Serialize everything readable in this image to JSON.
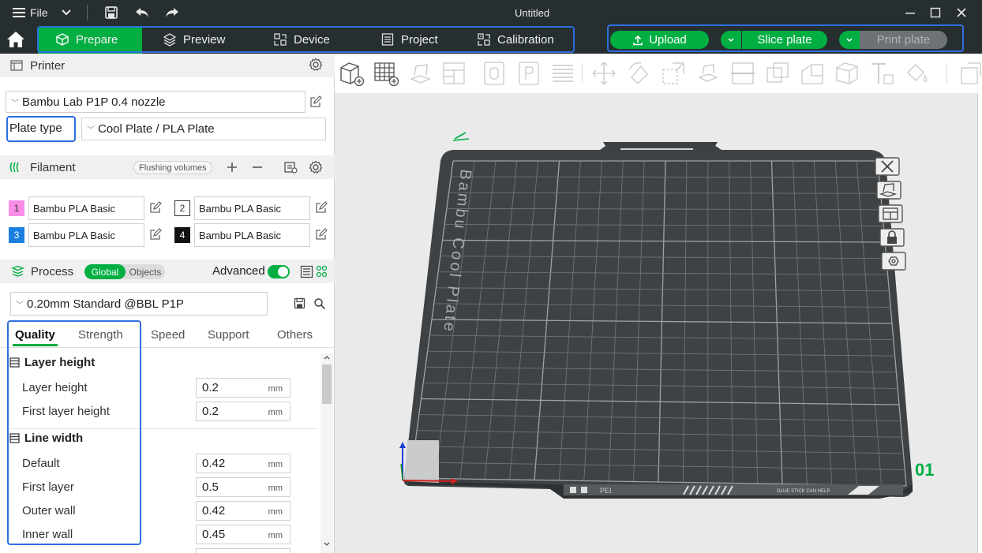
{
  "titlebar": {
    "menu_label": "File",
    "title": "Untitled"
  },
  "tabs": [
    {
      "label": "Prepare"
    },
    {
      "label": "Preview"
    },
    {
      "label": "Device"
    },
    {
      "label": "Project"
    },
    {
      "label": "Calibration"
    }
  ],
  "actions": {
    "upload": "Upload",
    "slice": "Slice plate",
    "print": "Print plate"
  },
  "printer": {
    "section_label": "Printer",
    "selected": "Bambu Lab P1P 0.4 nozzle",
    "plate_type_label": "Plate type",
    "plate_type_value": "Cool Plate / PLA Plate"
  },
  "filament": {
    "section_label": "Filament",
    "flushing_label": "Flushing volumes",
    "items": [
      {
        "num": "1",
        "name": "Bambu PLA Basic",
        "color": "#f98ee8"
      },
      {
        "num": "2",
        "name": "Bambu PLA Basic",
        "color": "#ffffff"
      },
      {
        "num": "3",
        "name": "Bambu PLA Basic",
        "color": "#1b7fe0"
      },
      {
        "num": "4",
        "name": "Bambu PLA Basic",
        "color": "#111111"
      }
    ]
  },
  "process": {
    "section_label": "Process",
    "toggle_global": "Global",
    "toggle_objects": "Objects",
    "advanced_label": "Advanced",
    "preset": "0.20mm Standard @BBL P1P",
    "tabs": [
      "Quality",
      "Strength",
      "Speed",
      "Support",
      "Others"
    ],
    "groups": [
      {
        "title": "Layer height",
        "options": [
          {
            "label": "Layer height",
            "value": "0.2",
            "unit": "mm"
          },
          {
            "label": "First layer height",
            "value": "0.2",
            "unit": "mm"
          }
        ]
      },
      {
        "title": "Line width",
        "options": [
          {
            "label": "Default",
            "value": "0.42",
            "unit": "mm"
          },
          {
            "label": "First layer",
            "value": "0.5",
            "unit": "mm"
          },
          {
            "label": "Outer wall",
            "value": "0.42",
            "unit": "mm"
          },
          {
            "label": "Inner wall",
            "value": "0.45",
            "unit": "mm"
          }
        ]
      }
    ]
  },
  "plate": {
    "brand_text": "Bambu Cool Plate",
    "plate_number": "01",
    "footer_text": "PEI",
    "glue_text": "GLUE STICK CAN HELP"
  },
  "colors": {
    "accent": "#00ae42",
    "header_bg": "#262e30",
    "highlight": "#2f6fe0"
  }
}
